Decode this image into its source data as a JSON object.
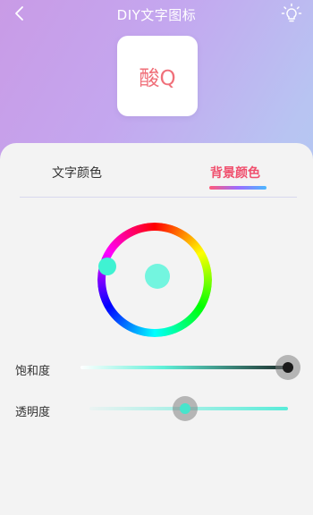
{
  "header": {
    "title": "DIY文字图标",
    "back_icon": "chevron-left-icon",
    "bulb_icon": "lightbulb-icon"
  },
  "preview": {
    "text": "酸Q",
    "text_color": "#f0707a",
    "background_color": "#ffffff"
  },
  "tabs": [
    {
      "label": "文字颜色",
      "active": false
    },
    {
      "label": "背景颜色",
      "active": true
    }
  ],
  "color_picker": {
    "selected_color": "#73f5df"
  },
  "sliders": {
    "saturation": {
      "label": "饱和度",
      "value": 1.0
    },
    "opacity": {
      "label": "透明度",
      "value": 0.48
    }
  },
  "colors": {
    "accent": "#f0506e",
    "teal": "#58ecd9"
  }
}
